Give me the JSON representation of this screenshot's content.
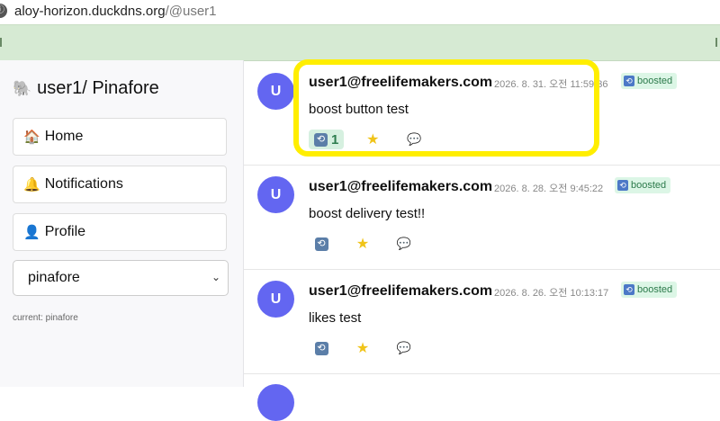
{
  "browser": {
    "url_host": "aloy-horizon.duckdns.org",
    "url_path": "/@user1"
  },
  "sidebar": {
    "brand": "user1/ Pinafore",
    "nav": [
      {
        "label": "Home",
        "icon": "house-icon"
      },
      {
        "label": "Notifications",
        "icon": "bell-icon"
      },
      {
        "label": "Profile",
        "icon": "person-icon"
      }
    ],
    "instance_select": "pinafore",
    "current": "current: pinafore"
  },
  "posts": [
    {
      "avatar": "U",
      "author": "user1@freelifemakers.com",
      "time": "2026. 8. 31. 오전 11:59:36",
      "badge": "boosted",
      "content": "boost button test",
      "boost_count": "1"
    },
    {
      "avatar": "U",
      "author": "user1@freelifemakers.com",
      "time": "2026. 8. 28. 오전 9:45:22",
      "badge": "boosted",
      "content": "boost delivery test!!"
    },
    {
      "avatar": "U",
      "author": "user1@freelifemakers.com",
      "time": "2026. 8. 26. 오전 10:13:17",
      "badge": "boosted",
      "content": "likes test"
    }
  ],
  "colors": {
    "accent": "#6366f1",
    "boosted_bg": "#dcf6e6",
    "highlight": "#ffee00"
  }
}
